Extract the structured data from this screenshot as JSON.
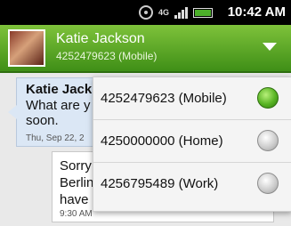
{
  "status_bar": {
    "icons": [
      "gps-icon",
      "network-icon",
      "signal-icon",
      "battery-icon"
    ],
    "network_label": "4G",
    "time": "10:42 AM"
  },
  "header": {
    "contact_name": "Katie Jackson",
    "contact_number": "4252479623 (Mobile)"
  },
  "messages": [
    {
      "sender": "Katie Jack",
      "text": "What are y",
      "text2": "soon.",
      "time": "Thu, Sep 22, 2"
    },
    {
      "text_line1": "Sorry",
      "text_line2": "Berlin",
      "text_line3": "have",
      "time": "9:30 AM"
    }
  ],
  "dropdown": {
    "options": [
      {
        "label": "4252479623 (Mobile)",
        "selected": true
      },
      {
        "label": "4250000000 (Home)",
        "selected": false
      },
      {
        "label": "4256795489 (Work)",
        "selected": false
      }
    ]
  },
  "colors": {
    "accent": "#5aa625",
    "header_top": "#7ec23a",
    "header_bottom": "#3f8f17"
  }
}
